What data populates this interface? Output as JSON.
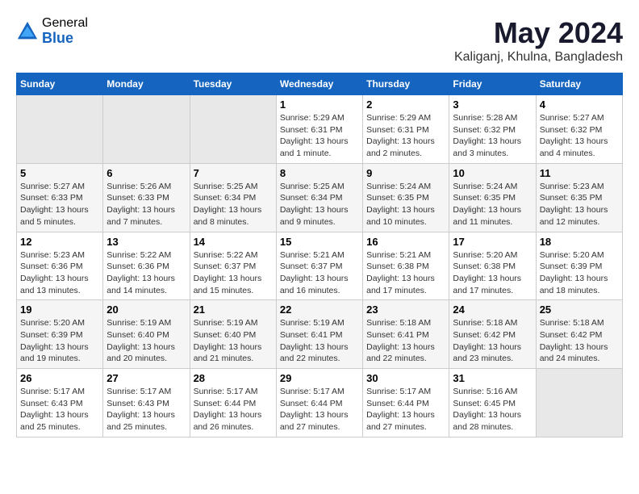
{
  "logo": {
    "general": "General",
    "blue": "Blue"
  },
  "title": "May 2024",
  "subtitle": "Kaliganj, Khulna, Bangladesh",
  "headers": [
    "Sunday",
    "Monday",
    "Tuesday",
    "Wednesday",
    "Thursday",
    "Friday",
    "Saturday"
  ],
  "weeks": [
    [
      {
        "day": "",
        "info": ""
      },
      {
        "day": "",
        "info": ""
      },
      {
        "day": "",
        "info": ""
      },
      {
        "day": "1",
        "info": "Sunrise: 5:29 AM\nSunset: 6:31 PM\nDaylight: 13 hours\nand 1 minute."
      },
      {
        "day": "2",
        "info": "Sunrise: 5:29 AM\nSunset: 6:31 PM\nDaylight: 13 hours\nand 2 minutes."
      },
      {
        "day": "3",
        "info": "Sunrise: 5:28 AM\nSunset: 6:32 PM\nDaylight: 13 hours\nand 3 minutes."
      },
      {
        "day": "4",
        "info": "Sunrise: 5:27 AM\nSunset: 6:32 PM\nDaylight: 13 hours\nand 4 minutes."
      }
    ],
    [
      {
        "day": "5",
        "info": "Sunrise: 5:27 AM\nSunset: 6:33 PM\nDaylight: 13 hours\nand 5 minutes."
      },
      {
        "day": "6",
        "info": "Sunrise: 5:26 AM\nSunset: 6:33 PM\nDaylight: 13 hours\nand 7 minutes."
      },
      {
        "day": "7",
        "info": "Sunrise: 5:25 AM\nSunset: 6:34 PM\nDaylight: 13 hours\nand 8 minutes."
      },
      {
        "day": "8",
        "info": "Sunrise: 5:25 AM\nSunset: 6:34 PM\nDaylight: 13 hours\nand 9 minutes."
      },
      {
        "day": "9",
        "info": "Sunrise: 5:24 AM\nSunset: 6:35 PM\nDaylight: 13 hours\nand 10 minutes."
      },
      {
        "day": "10",
        "info": "Sunrise: 5:24 AM\nSunset: 6:35 PM\nDaylight: 13 hours\nand 11 minutes."
      },
      {
        "day": "11",
        "info": "Sunrise: 5:23 AM\nSunset: 6:35 PM\nDaylight: 13 hours\nand 12 minutes."
      }
    ],
    [
      {
        "day": "12",
        "info": "Sunrise: 5:23 AM\nSunset: 6:36 PM\nDaylight: 13 hours\nand 13 minutes."
      },
      {
        "day": "13",
        "info": "Sunrise: 5:22 AM\nSunset: 6:36 PM\nDaylight: 13 hours\nand 14 minutes."
      },
      {
        "day": "14",
        "info": "Sunrise: 5:22 AM\nSunset: 6:37 PM\nDaylight: 13 hours\nand 15 minutes."
      },
      {
        "day": "15",
        "info": "Sunrise: 5:21 AM\nSunset: 6:37 PM\nDaylight: 13 hours\nand 16 minutes."
      },
      {
        "day": "16",
        "info": "Sunrise: 5:21 AM\nSunset: 6:38 PM\nDaylight: 13 hours\nand 17 minutes."
      },
      {
        "day": "17",
        "info": "Sunrise: 5:20 AM\nSunset: 6:38 PM\nDaylight: 13 hours\nand 17 minutes."
      },
      {
        "day": "18",
        "info": "Sunrise: 5:20 AM\nSunset: 6:39 PM\nDaylight: 13 hours\nand 18 minutes."
      }
    ],
    [
      {
        "day": "19",
        "info": "Sunrise: 5:20 AM\nSunset: 6:39 PM\nDaylight: 13 hours\nand 19 minutes."
      },
      {
        "day": "20",
        "info": "Sunrise: 5:19 AM\nSunset: 6:40 PM\nDaylight: 13 hours\nand 20 minutes."
      },
      {
        "day": "21",
        "info": "Sunrise: 5:19 AM\nSunset: 6:40 PM\nDaylight: 13 hours\nand 21 minutes."
      },
      {
        "day": "22",
        "info": "Sunrise: 5:19 AM\nSunset: 6:41 PM\nDaylight: 13 hours\nand 22 minutes."
      },
      {
        "day": "23",
        "info": "Sunrise: 5:18 AM\nSunset: 6:41 PM\nDaylight: 13 hours\nand 22 minutes."
      },
      {
        "day": "24",
        "info": "Sunrise: 5:18 AM\nSunset: 6:42 PM\nDaylight: 13 hours\nand 23 minutes."
      },
      {
        "day": "25",
        "info": "Sunrise: 5:18 AM\nSunset: 6:42 PM\nDaylight: 13 hours\nand 24 minutes."
      }
    ],
    [
      {
        "day": "26",
        "info": "Sunrise: 5:17 AM\nSunset: 6:43 PM\nDaylight: 13 hours\nand 25 minutes."
      },
      {
        "day": "27",
        "info": "Sunrise: 5:17 AM\nSunset: 6:43 PM\nDaylight: 13 hours\nand 25 minutes."
      },
      {
        "day": "28",
        "info": "Sunrise: 5:17 AM\nSunset: 6:44 PM\nDaylight: 13 hours\nand 26 minutes."
      },
      {
        "day": "29",
        "info": "Sunrise: 5:17 AM\nSunset: 6:44 PM\nDaylight: 13 hours\nand 27 minutes."
      },
      {
        "day": "30",
        "info": "Sunrise: 5:17 AM\nSunset: 6:44 PM\nDaylight: 13 hours\nand 27 minutes."
      },
      {
        "day": "31",
        "info": "Sunrise: 5:16 AM\nSunset: 6:45 PM\nDaylight: 13 hours\nand 28 minutes."
      },
      {
        "day": "",
        "info": ""
      }
    ]
  ]
}
